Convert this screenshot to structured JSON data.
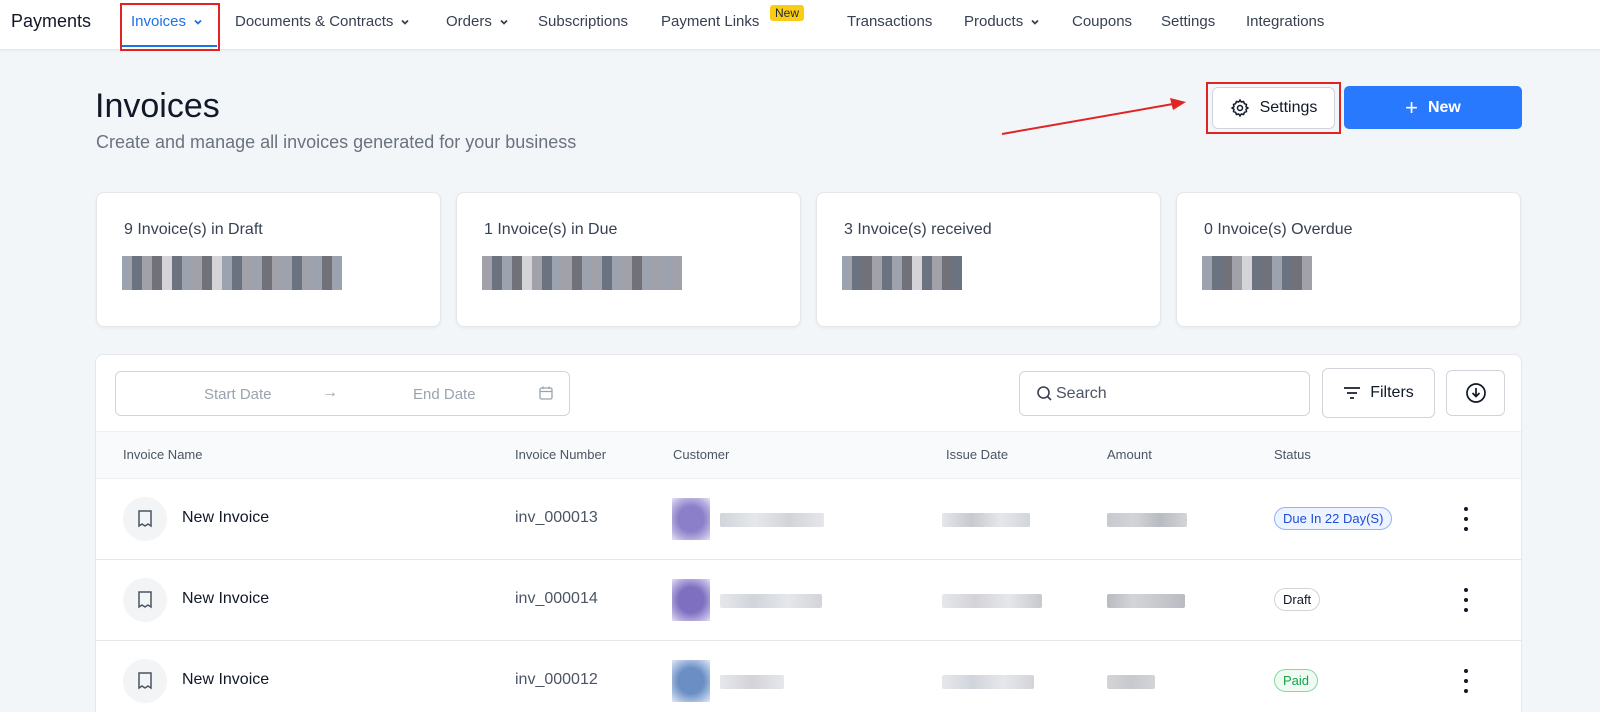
{
  "nav": {
    "brand": "Payments",
    "items": [
      {
        "label": "Invoices",
        "has_dropdown": true,
        "active": true
      },
      {
        "label": "Documents & Contracts",
        "has_dropdown": true
      },
      {
        "label": "Orders",
        "has_dropdown": true
      },
      {
        "label": "Subscriptions"
      },
      {
        "label": "Payment Links",
        "badge": "New"
      },
      {
        "label": "Transactions"
      },
      {
        "label": "Products",
        "has_dropdown": true
      },
      {
        "label": "Coupons"
      },
      {
        "label": "Settings"
      },
      {
        "label": "Integrations"
      }
    ]
  },
  "header": {
    "title": "Invoices",
    "subtitle": "Create and manage all invoices generated for your business",
    "settings_label": "Settings",
    "new_label": "New"
  },
  "stats": [
    {
      "label": "9 Invoice(s) in Draft"
    },
    {
      "label": "1 Invoice(s) in Due"
    },
    {
      "label": "3 Invoice(s) received"
    },
    {
      "label": "0 Invoice(s) Overdue"
    }
  ],
  "toolbar": {
    "start_date_placeholder": "Start Date",
    "end_date_placeholder": "End Date",
    "search_placeholder": "Search",
    "filters_label": "Filters"
  },
  "table": {
    "columns": [
      "Invoice Name",
      "Invoice Number",
      "Customer",
      "Issue Date",
      "Amount",
      "Status"
    ],
    "rows": [
      {
        "name": "New Invoice",
        "number": "inv_000013",
        "status": "Due In 22 Day(S)",
        "status_type": "due"
      },
      {
        "name": "New Invoice",
        "number": "inv_000014",
        "status": "Draft",
        "status_type": "draft"
      },
      {
        "name": "New Invoice",
        "number": "inv_000012",
        "status": "Paid",
        "status_type": "paid"
      }
    ]
  },
  "colors": {
    "accent": "#2979ff",
    "nav_active": "#1a73e8",
    "highlight_red": "#e02424",
    "badge_yellow": "#facc15"
  },
  "icons": [
    "chevron-down-icon",
    "gear-icon",
    "plus-icon",
    "calendar-icon",
    "search-icon",
    "filter-icon",
    "download-icon",
    "document-icon",
    "kebab-menu-icon"
  ]
}
